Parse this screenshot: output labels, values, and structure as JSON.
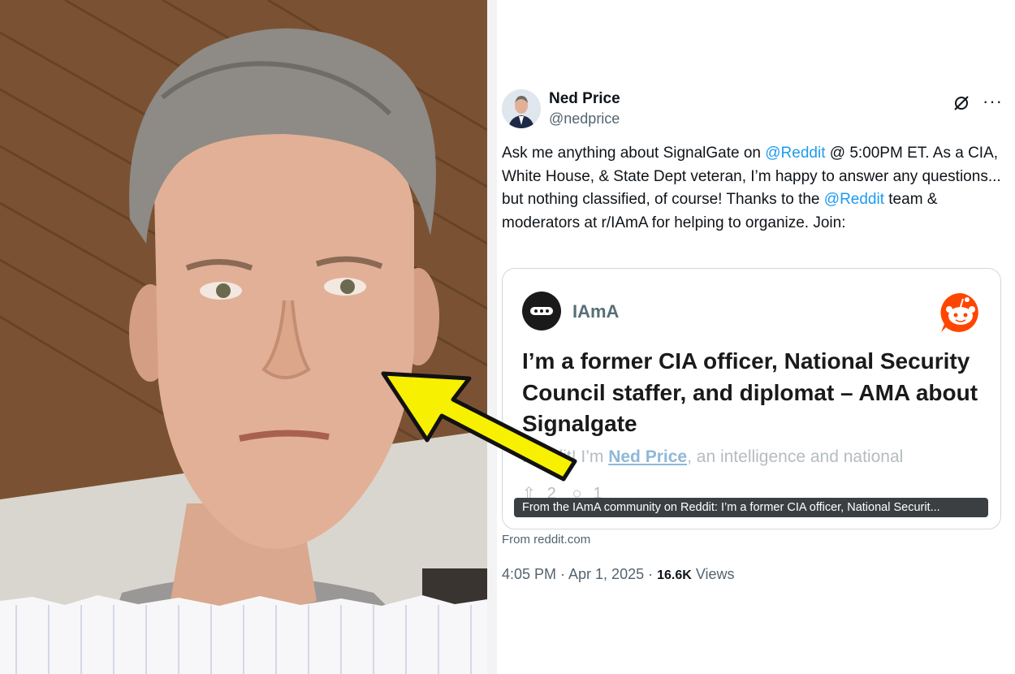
{
  "tweet": {
    "author_name": "Ned Price",
    "author_handle": "@nedprice",
    "text_part1": "Ask me anything about SignalGate on ",
    "mention1": "@Reddit",
    "text_part2": " @ 5:00PM ET. As a CIA, White House, & State Dept veteran, I’m happy to answer any questions... but nothing classified, of course! Thanks to the ",
    "mention2": "@Reddit",
    "text_part3": " team & moderators at r/IAmA for helping to organize. Join:",
    "more_label": "···",
    "card": {
      "subreddit": "IAmA",
      "title": "I’m a former CIA officer, National Security Council staffer, and diplomat – AMA about Signalgate",
      "snippet_before": "Reddit! I’m ",
      "snippet_link": "Ned Price",
      "snippet_after": ", an intelligence and national",
      "upvotes": "2",
      "comments": "1",
      "tooltip": "From the IAmA community on Reddit: I’m a former CIA officer, National Securit..."
    },
    "from_link": "From reddit.com",
    "timestamp": "4:05 PM · Apr 1, 2025 · ",
    "views_count": "16.6K",
    "views_label": " Views"
  },
  "colors": {
    "accent": "#1d9bf0",
    "reddit_orange": "#ff4500",
    "arrow_yellow": "#f7f000"
  }
}
